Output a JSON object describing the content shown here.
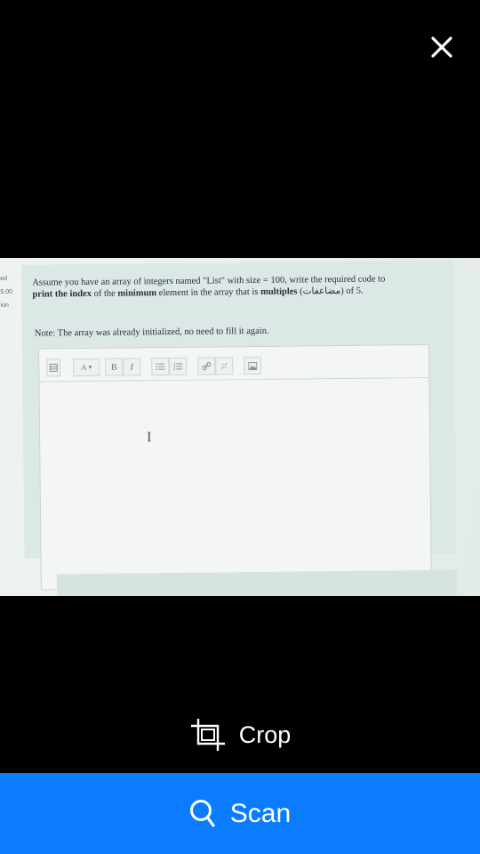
{
  "toolbar_top": {
    "close_icon": "close-icon"
  },
  "photo": {
    "side_labels": [
      "ed",
      "5.00",
      "ion"
    ],
    "question_line1": "Assume you have an array of integers named \"List\" with size = 100, write the required code to",
    "question_line2_bold1": "print the index",
    "question_line2_mid1": " of the ",
    "question_line2_bold2": "minimum",
    "question_line2_mid2": " element in the array that is ",
    "question_line2_bold3": "multiples",
    "question_line2_arabic": "(مضاعفات)",
    "question_line2_end": " of 5.",
    "note": "Note: The array was already initialized, no need to fill it again.",
    "editor_buttons": {
      "bold": "B",
      "italic": "I"
    },
    "cursor_glyph": "I"
  },
  "actions": {
    "crop_label": "Crop",
    "scan_label": "Scan"
  },
  "colors": {
    "scan_bar": "#0b7cff",
    "background": "#000000"
  }
}
